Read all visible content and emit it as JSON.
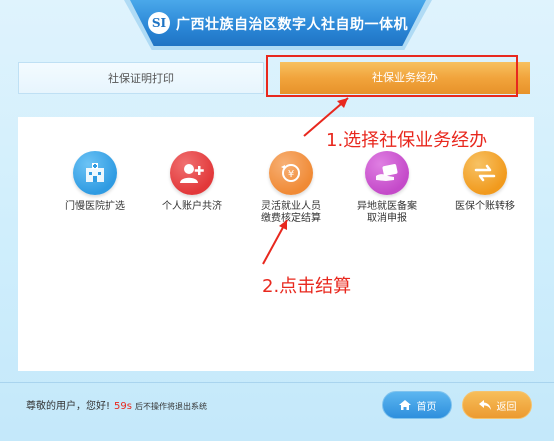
{
  "header": {
    "logo_text": "SI",
    "title": "广西壮族自治区数字人社自助一体机"
  },
  "tabs": [
    {
      "label": "社保证明打印",
      "active": false
    },
    {
      "label": "社保业务经办",
      "active": true
    }
  ],
  "services": [
    {
      "label_line1": "门慢医院扩选",
      "label_line2": "",
      "icon": "hospital-icon",
      "color": "#2f9be2"
    },
    {
      "label_line1": "个人账户共济",
      "label_line2": "",
      "icon": "user-add-icon",
      "color": "#e2383a"
    },
    {
      "label_line1": "灵活就业人员",
      "label_line2": "缴费核定结算",
      "icon": "money-refund-icon",
      "color": "#f08a35"
    },
    {
      "label_line1": "异地就医备案",
      "label_line2": "取消申报",
      "icon": "hand-card-icon",
      "color": "#c44ac9"
    },
    {
      "label_line1": "医保个账转移",
      "label_line2": "",
      "icon": "transfer-arrows-icon",
      "color": "#f19a1d"
    }
  ],
  "annotations": {
    "step1": "1.选择社保业务经办",
    "step2": "2.点击结算"
  },
  "footer": {
    "greeting": "尊敬的用户，您好!",
    "countdown": "59s",
    "exit_notice": "后不操作将退出系统",
    "home_label": "首页",
    "back_label": "返回"
  },
  "colors": {
    "title_blue": "#2a86d6",
    "active_tab_orange": "#f1a43c",
    "annotation_red": "#e8281e"
  }
}
